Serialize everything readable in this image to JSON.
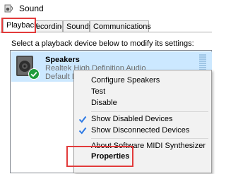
{
  "window": {
    "title": "Sound"
  },
  "tabs": [
    {
      "label": "Playback",
      "active": true
    },
    {
      "label": "Recording",
      "active": false
    },
    {
      "label": "Sounds",
      "active": false
    },
    {
      "label": "Communications",
      "active": false
    }
  ],
  "instruction": "Select a playback device below to modify its settings:",
  "device": {
    "name": "Speakers",
    "description": "Realtek High Definition Audio",
    "status": "Default Device",
    "icon": "speaker-icon",
    "badge": "green-check-icon"
  },
  "context_menu": {
    "items": [
      {
        "label": "Configure Speakers",
        "checked": false
      },
      {
        "label": "Test",
        "checked": false
      },
      {
        "label": "Disable",
        "checked": false
      },
      {
        "separator": true
      },
      {
        "label": "Show Disabled Devices",
        "checked": true
      },
      {
        "label": "Show Disconnected Devices",
        "checked": true
      },
      {
        "separator": true
      },
      {
        "label": "About Software MIDI Synthesizer",
        "checked": false
      },
      {
        "label": "Properties",
        "checked": false,
        "bold": true
      }
    ]
  },
  "colors": {
    "highlight_box": "#e23b3b",
    "selection": "#cce8ff",
    "checkmark": "#2b78e4",
    "default_badge": "#1f9c3b"
  }
}
